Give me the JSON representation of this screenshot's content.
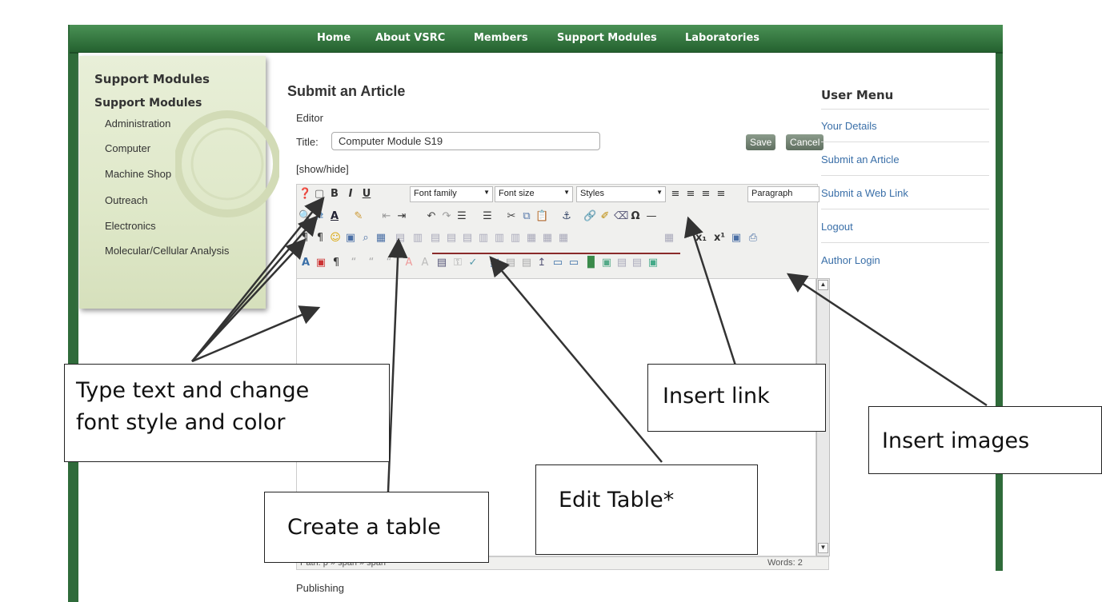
{
  "nav": [
    "Home",
    "About VSRC",
    "Members",
    "Support Modules",
    "Laboratories"
  ],
  "left_panel": {
    "heading": "Support Modules",
    "subheading": "Support Modules",
    "items": [
      "Administration",
      "Computer",
      "Machine Shop",
      "Outreach",
      "Electronics",
      "Molecular/Cellular Analysis"
    ]
  },
  "main": {
    "title": "Submit an Article",
    "editor_label": "Editor",
    "title_label": "Title:",
    "title_value": "Computer Module S19",
    "show_hide": "[show/hide]",
    "save_label": "Save",
    "cancel_label": "Cancel",
    "publishing_label": "Publishing"
  },
  "toolbar": {
    "font_family": "Font family",
    "font_size": "Font size",
    "styles": "Styles",
    "paragraph": "Paragraph"
  },
  "status": {
    "path": "Path: p » span » span",
    "words": "Words: 2"
  },
  "user_menu": {
    "heading": "User Menu",
    "items": [
      "Your Details",
      "Submit an Article",
      "Submit a Web Link",
      "Logout",
      "Author Login"
    ]
  },
  "callouts": {
    "type_text": [
      "Type text and change",
      "font style and color"
    ],
    "insert_link": "Insert link",
    "insert_images": "Insert images",
    "edit_table": "Edit Table*",
    "create_table": "Create a table"
  },
  "colors": {
    "nav_bar": "#2f6b3a",
    "left_panel": "#e3ebd0",
    "link": "#3a6fa8"
  }
}
